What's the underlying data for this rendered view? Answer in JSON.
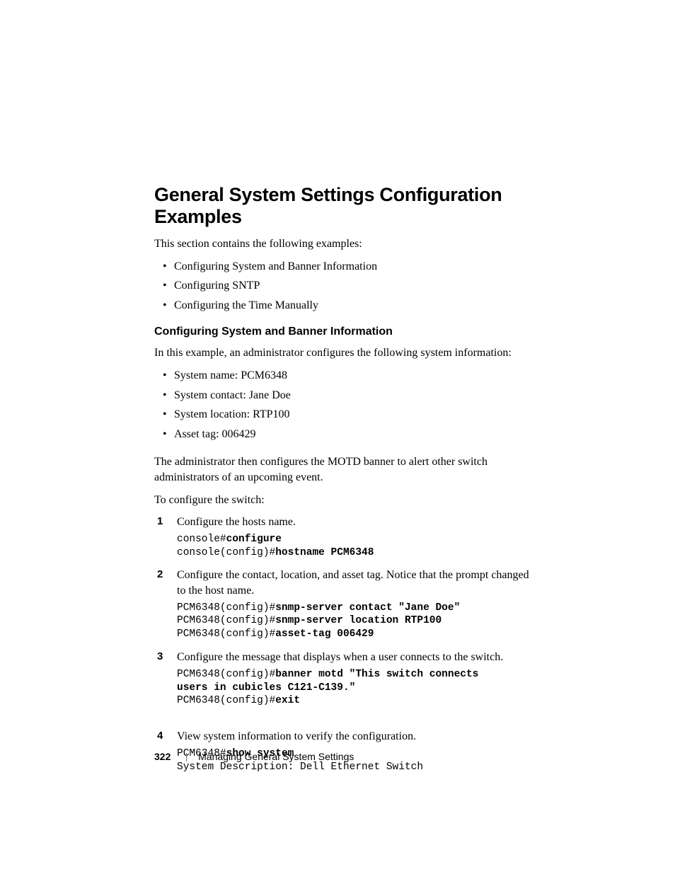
{
  "title": "General System Settings Configuration Examples",
  "intro": "This section contains the following examples:",
  "toc": [
    "Configuring System and Banner Information",
    "Configuring SNTP",
    "Configuring the Time Manually"
  ],
  "section1": {
    "heading": "Configuring System and Banner Information",
    "p1": "In this example, an administrator configures the following system information:",
    "info": [
      "System name: PCM6348",
      "System contact: Jane Doe",
      "System location: RTP100",
      "Asset tag: 006429"
    ],
    "p2": "The administrator then configures the MOTD banner to alert other switch administrators of an upcoming event.",
    "p3": "To configure the switch:",
    "steps": [
      {
        "text": "Configure the hosts name.",
        "code": [
          {
            "plain": "console#",
            "bold": "configure"
          },
          {
            "plain": "console(config)#",
            "bold": "hostname PCM6348"
          }
        ]
      },
      {
        "text": "Configure the contact, location, and asset tag. Notice that the prompt changed to the host name.",
        "code": [
          {
            "plain": "PCM6348(config)#",
            "bold": "snmp-server contact \"Jane Doe\""
          },
          {
            "plain": "PCM6348(config)#",
            "bold": "snmp-server location RTP100"
          },
          {
            "plain": "PCM6348(config)#",
            "bold": "asset-tag 006429"
          }
        ]
      },
      {
        "text": "Configure the message that displays when a user connects to the switch.",
        "code": [
          {
            "plain": "PCM6348(config)#",
            "bold": "banner motd \"This switch connects"
          },
          {
            "plain": "",
            "bold": "users in cubicles C121-C139.\""
          },
          {
            "plain": "PCM6348(config)#",
            "bold": "exit"
          }
        ],
        "extra_gap": true
      },
      {
        "text": "View system information to verify the configuration.",
        "code": [
          {
            "plain": "PCM6348#",
            "bold": "show system"
          },
          {
            "plain": "System Description: Dell Ethernet Switch",
            "bold": ""
          }
        ]
      }
    ]
  },
  "footer": {
    "page": "322",
    "section": "Managing General System Settings"
  }
}
